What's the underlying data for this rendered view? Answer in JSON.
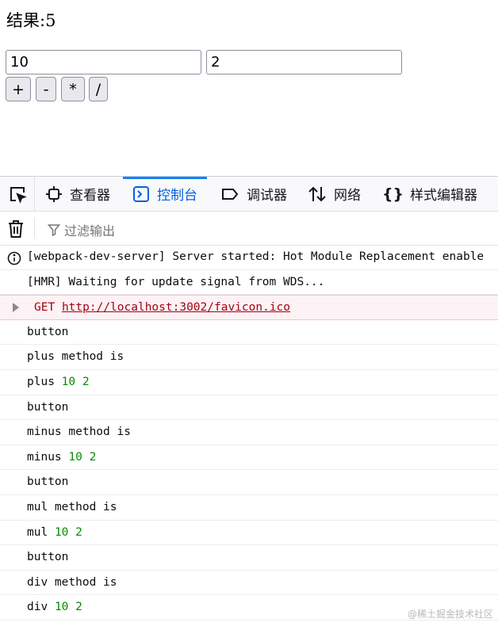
{
  "app": {
    "result_text": "结果:5",
    "input1_value": "10",
    "input2_value": "2",
    "buttons": {
      "plus": "+",
      "minus": "-",
      "mul": "*",
      "div": "/"
    }
  },
  "devtools": {
    "tabs": {
      "inspector": "查看器",
      "console": "控制台",
      "debugger": "调试器",
      "network": "网络",
      "style_editor": "样式编辑器"
    },
    "filter_placeholder": "过滤输出",
    "log": [
      {
        "text": "[webpack-dev-server] Server started: Hot Module Replacement enable"
      },
      {
        "text": "[HMR] Waiting for update signal from WDS..."
      },
      {
        "method": "GET",
        "url": "http://localhost:3002/favicon.ico"
      },
      {
        "text": "button"
      },
      {
        "text": "plus method is"
      },
      {
        "label": "plus",
        "a": "10",
        "b": "2"
      },
      {
        "text": "button"
      },
      {
        "text": "minus method is"
      },
      {
        "label": "minus",
        "a": "10",
        "b": "2"
      },
      {
        "text": "button"
      },
      {
        "text": "mul method is"
      },
      {
        "label": "mul",
        "a": "10",
        "b": "2"
      },
      {
        "text": "button"
      },
      {
        "text": "div method is"
      },
      {
        "label": "div",
        "a": "10",
        "b": "2"
      }
    ]
  },
  "watermark": "@稀土掘金技术社区",
  "colors": {
    "accent": "#0a84ff",
    "error_bg": "#fdf2f5",
    "number": "#058b00"
  }
}
